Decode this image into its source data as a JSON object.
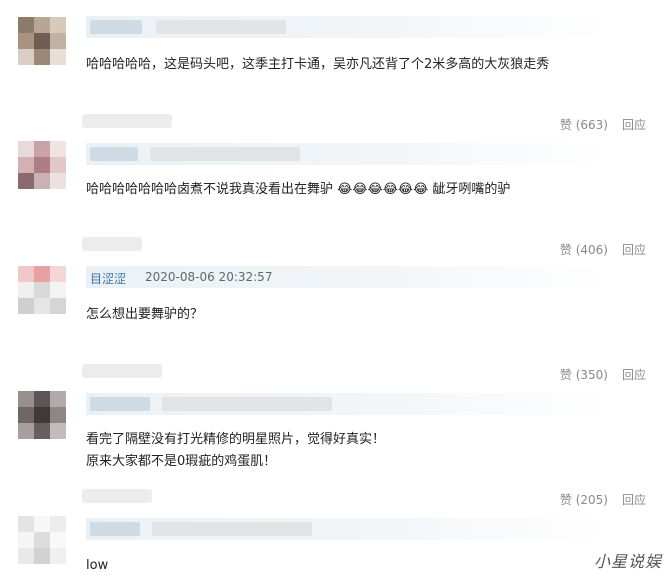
{
  "comments": [
    {
      "username": "",
      "time": "",
      "lines": [
        "哈哈哈哈哈，这是码头吧，这季主打卡通，吴亦凡还背了个2米多高的大灰狼走秀"
      ],
      "like_label": "赞 (663)",
      "reply_label": "回应"
    },
    {
      "username": "",
      "time": "",
      "lines": [
        "哈哈哈哈哈哈哈卤煮不说我真没看出在舞驴 😂😂😂😂😂😂 龇牙咧嘴的驴"
      ],
      "like_label": "赞 (406)",
      "reply_label": "回应"
    },
    {
      "username": "目涩涩",
      "time": "2020-08-06 20:32:57",
      "lines": [
        "怎么想出要舞驴的？"
      ],
      "like_label": "赞 (350)",
      "reply_label": "回应"
    },
    {
      "username": "",
      "time": "",
      "lines": [
        "看完了隔壁没有打光精修的明星照片，觉得好真实！",
        "原来大家都不是0瑕疵的鸡蛋肌！"
      ],
      "like_label": "赞 (205)",
      "reply_label": "回应"
    },
    {
      "username": "",
      "time": "",
      "lines": [
        "low"
      ],
      "like_label": "",
      "reply_label": ""
    }
  ],
  "watermark": "小星说娱",
  "colors": {
    "link": "#3a6ea5",
    "meta": "#8a8a8a",
    "bar": "#eaf1f6"
  }
}
